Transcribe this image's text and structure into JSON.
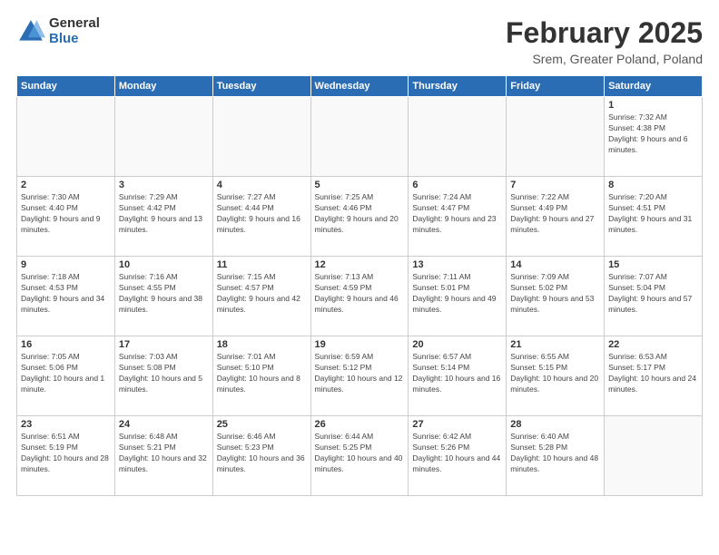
{
  "logo": {
    "general": "General",
    "blue": "Blue"
  },
  "title": {
    "main": "February 2025",
    "sub": "Srem, Greater Poland, Poland"
  },
  "header": {
    "days": [
      "Sunday",
      "Monday",
      "Tuesday",
      "Wednesday",
      "Thursday",
      "Friday",
      "Saturday"
    ]
  },
  "weeks": [
    [
      {
        "day": "",
        "info": ""
      },
      {
        "day": "",
        "info": ""
      },
      {
        "day": "",
        "info": ""
      },
      {
        "day": "",
        "info": ""
      },
      {
        "day": "",
        "info": ""
      },
      {
        "day": "",
        "info": ""
      },
      {
        "day": "1",
        "info": "Sunrise: 7:32 AM\nSunset: 4:38 PM\nDaylight: 9 hours and 6 minutes."
      }
    ],
    [
      {
        "day": "2",
        "info": "Sunrise: 7:30 AM\nSunset: 4:40 PM\nDaylight: 9 hours and 9 minutes."
      },
      {
        "day": "3",
        "info": "Sunrise: 7:29 AM\nSunset: 4:42 PM\nDaylight: 9 hours and 13 minutes."
      },
      {
        "day": "4",
        "info": "Sunrise: 7:27 AM\nSunset: 4:44 PM\nDaylight: 9 hours and 16 minutes."
      },
      {
        "day": "5",
        "info": "Sunrise: 7:25 AM\nSunset: 4:46 PM\nDaylight: 9 hours and 20 minutes."
      },
      {
        "day": "6",
        "info": "Sunrise: 7:24 AM\nSunset: 4:47 PM\nDaylight: 9 hours and 23 minutes."
      },
      {
        "day": "7",
        "info": "Sunrise: 7:22 AM\nSunset: 4:49 PM\nDaylight: 9 hours and 27 minutes."
      },
      {
        "day": "8",
        "info": "Sunrise: 7:20 AM\nSunset: 4:51 PM\nDaylight: 9 hours and 31 minutes."
      }
    ],
    [
      {
        "day": "9",
        "info": "Sunrise: 7:18 AM\nSunset: 4:53 PM\nDaylight: 9 hours and 34 minutes."
      },
      {
        "day": "10",
        "info": "Sunrise: 7:16 AM\nSunset: 4:55 PM\nDaylight: 9 hours and 38 minutes."
      },
      {
        "day": "11",
        "info": "Sunrise: 7:15 AM\nSunset: 4:57 PM\nDaylight: 9 hours and 42 minutes."
      },
      {
        "day": "12",
        "info": "Sunrise: 7:13 AM\nSunset: 4:59 PM\nDaylight: 9 hours and 46 minutes."
      },
      {
        "day": "13",
        "info": "Sunrise: 7:11 AM\nSunset: 5:01 PM\nDaylight: 9 hours and 49 minutes."
      },
      {
        "day": "14",
        "info": "Sunrise: 7:09 AM\nSunset: 5:02 PM\nDaylight: 9 hours and 53 minutes."
      },
      {
        "day": "15",
        "info": "Sunrise: 7:07 AM\nSunset: 5:04 PM\nDaylight: 9 hours and 57 minutes."
      }
    ],
    [
      {
        "day": "16",
        "info": "Sunrise: 7:05 AM\nSunset: 5:06 PM\nDaylight: 10 hours and 1 minute."
      },
      {
        "day": "17",
        "info": "Sunrise: 7:03 AM\nSunset: 5:08 PM\nDaylight: 10 hours and 5 minutes."
      },
      {
        "day": "18",
        "info": "Sunrise: 7:01 AM\nSunset: 5:10 PM\nDaylight: 10 hours and 8 minutes."
      },
      {
        "day": "19",
        "info": "Sunrise: 6:59 AM\nSunset: 5:12 PM\nDaylight: 10 hours and 12 minutes."
      },
      {
        "day": "20",
        "info": "Sunrise: 6:57 AM\nSunset: 5:14 PM\nDaylight: 10 hours and 16 minutes."
      },
      {
        "day": "21",
        "info": "Sunrise: 6:55 AM\nSunset: 5:15 PM\nDaylight: 10 hours and 20 minutes."
      },
      {
        "day": "22",
        "info": "Sunrise: 6:53 AM\nSunset: 5:17 PM\nDaylight: 10 hours and 24 minutes."
      }
    ],
    [
      {
        "day": "23",
        "info": "Sunrise: 6:51 AM\nSunset: 5:19 PM\nDaylight: 10 hours and 28 minutes."
      },
      {
        "day": "24",
        "info": "Sunrise: 6:48 AM\nSunset: 5:21 PM\nDaylight: 10 hours and 32 minutes."
      },
      {
        "day": "25",
        "info": "Sunrise: 6:46 AM\nSunset: 5:23 PM\nDaylight: 10 hours and 36 minutes."
      },
      {
        "day": "26",
        "info": "Sunrise: 6:44 AM\nSunset: 5:25 PM\nDaylight: 10 hours and 40 minutes."
      },
      {
        "day": "27",
        "info": "Sunrise: 6:42 AM\nSunset: 5:26 PM\nDaylight: 10 hours and 44 minutes."
      },
      {
        "day": "28",
        "info": "Sunrise: 6:40 AM\nSunset: 5:28 PM\nDaylight: 10 hours and 48 minutes."
      },
      {
        "day": "",
        "info": ""
      }
    ]
  ]
}
